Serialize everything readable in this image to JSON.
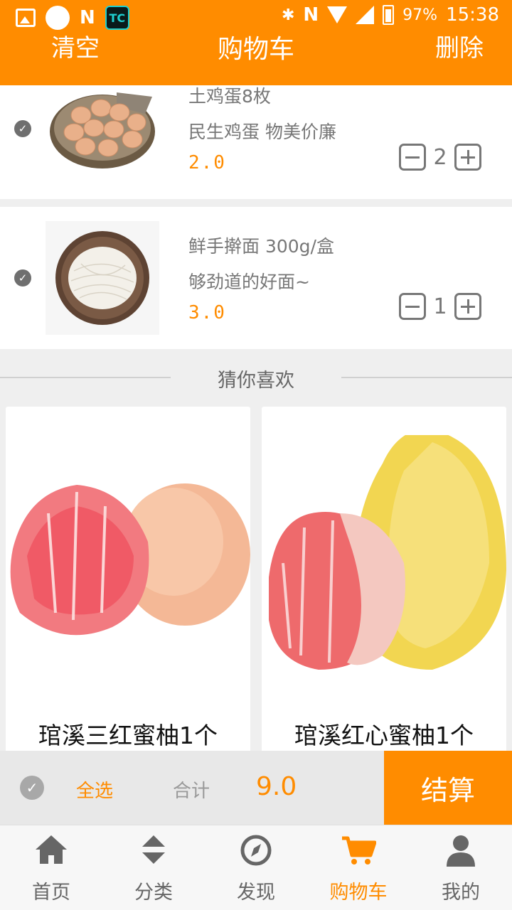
{
  "status_bar": {
    "battery": "97%",
    "time": "15:38"
  },
  "header": {
    "left_action": "清空",
    "title": "购物车",
    "right_action": "删除"
  },
  "cart_items": [
    {
      "name": "土鸡蛋8枚",
      "desc": "民生鸡蛋 物美价廉",
      "price": "2.0",
      "qty": "2",
      "checked": true
    },
    {
      "name": "鲜手擀面 300g/盒",
      "desc": "够劲道的好面~",
      "price": "3.0",
      "qty": "1",
      "checked": true
    }
  ],
  "recommend": {
    "title": "猜你喜欢",
    "products": [
      {
        "name": "琯溪三红蜜柚1个"
      },
      {
        "name": "琯溪红心蜜柚1个"
      }
    ]
  },
  "totals": {
    "select_all": "全选",
    "sum_label": "合计",
    "sum_value": "9.0",
    "checkout": "结算"
  },
  "tabs": [
    {
      "label": "首页",
      "icon": "home-icon",
      "active": false
    },
    {
      "label": "分类",
      "icon": "sort-icon",
      "active": false
    },
    {
      "label": "发现",
      "icon": "compass-icon",
      "active": false
    },
    {
      "label": "购物车",
      "icon": "cart-icon",
      "active": true
    },
    {
      "label": "我的",
      "icon": "user-icon",
      "active": false
    }
  ],
  "colors": {
    "accent": "#ff8c00",
    "muted": "#777777",
    "background": "#efefef"
  }
}
